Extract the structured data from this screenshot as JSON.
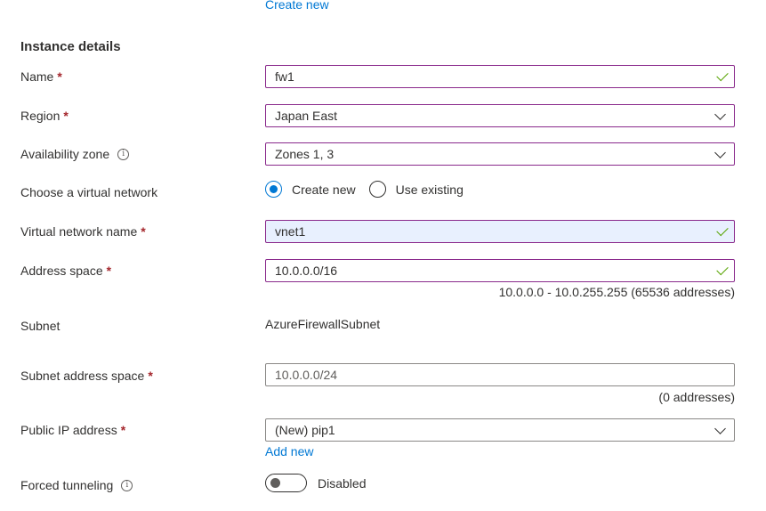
{
  "top_link": "Create new",
  "section_title": "Instance details",
  "fields": {
    "name": {
      "label": "Name",
      "value": "fw1"
    },
    "region": {
      "label": "Region",
      "value": "Japan East"
    },
    "availability_zone": {
      "label": "Availability zone",
      "value": "Zones 1, 3"
    },
    "virtual_network": {
      "label": "Choose a virtual network",
      "options": [
        "Create new",
        "Use existing"
      ],
      "selected": "Create new"
    },
    "vnet_name": {
      "label": "Virtual network name",
      "value": "vnet1"
    },
    "address_space": {
      "label": "Address space",
      "value": "10.0.0.0/16",
      "hint": "10.0.0.0 - 10.0.255.255 (65536 addresses)"
    },
    "subnet": {
      "label": "Subnet",
      "value": "AzureFirewallSubnet"
    },
    "subnet_address_space": {
      "label": "Subnet address space",
      "placeholder": "10.0.0.0/24",
      "hint": "(0 addresses)"
    },
    "public_ip": {
      "label": "Public IP address",
      "value": "(New) pip1",
      "link": "Add new"
    },
    "forced_tunneling": {
      "label": "Forced tunneling",
      "state": "Disabled"
    }
  },
  "required_mark": "*",
  "info_glyph": "i",
  "colors": {
    "link": "#0078d4",
    "valid_border": "#8a2a8c",
    "check": "#57a300",
    "required": "#a4262c"
  }
}
